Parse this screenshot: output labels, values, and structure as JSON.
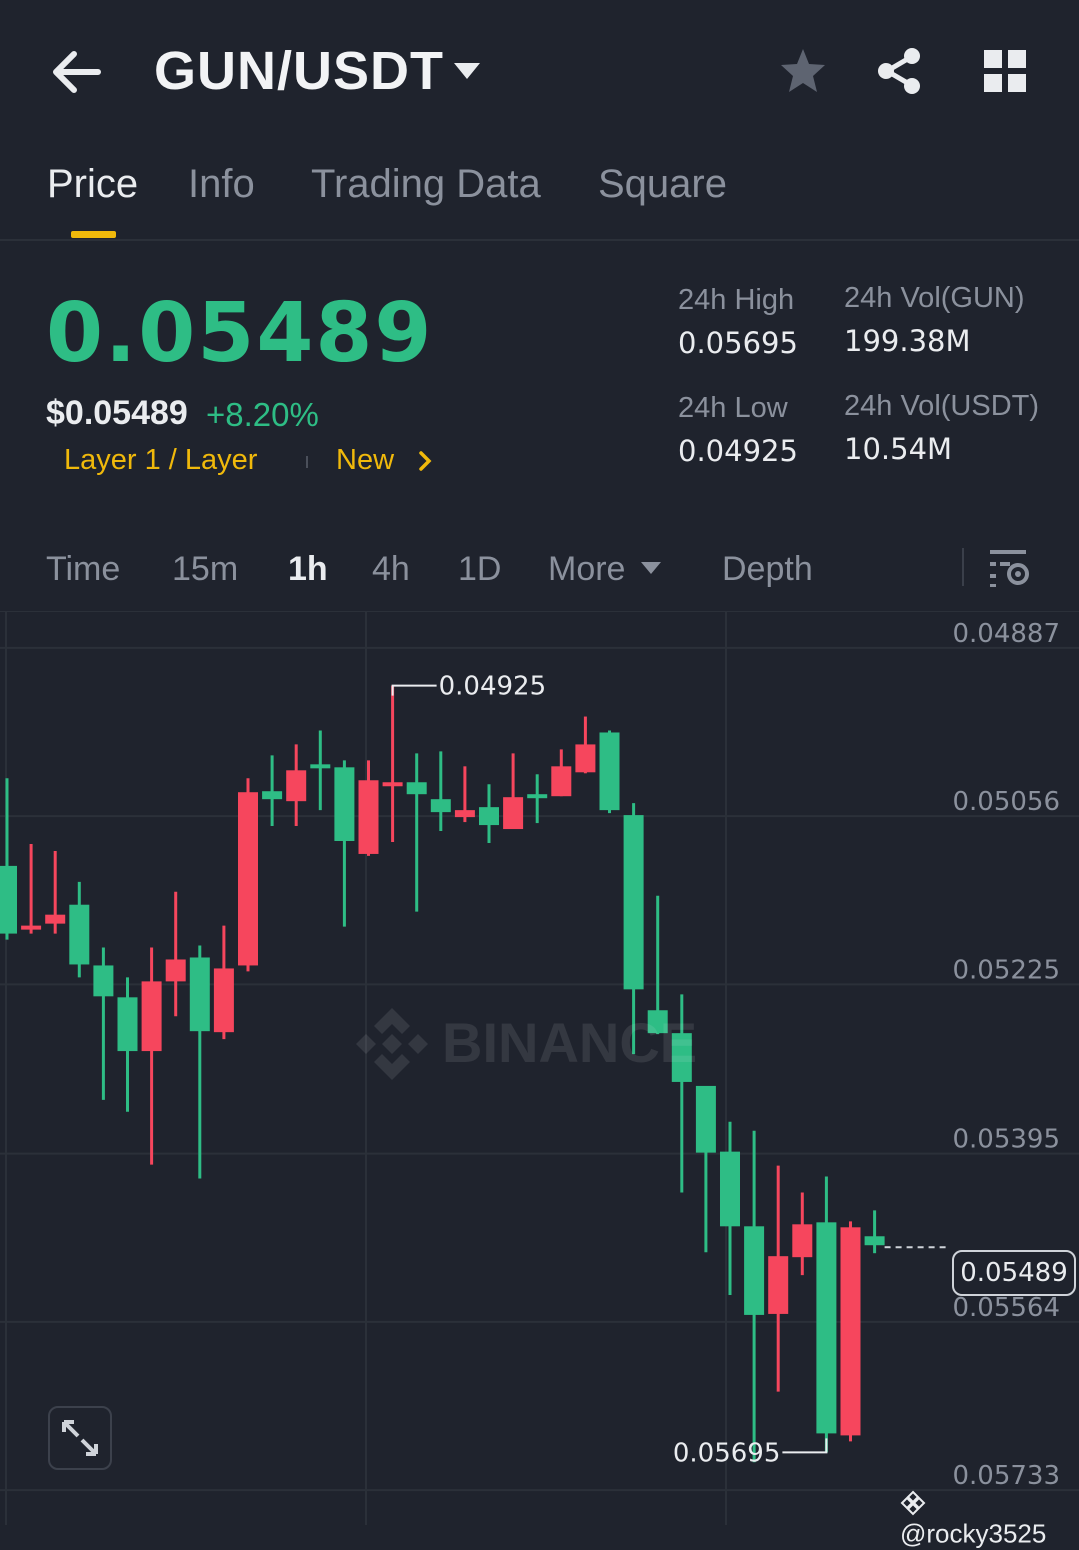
{
  "header": {
    "pair": "GUN/USDT",
    "icons": [
      "arrow-left-icon",
      "caret-down-icon",
      "star-icon",
      "share-icon",
      "grid-icon"
    ]
  },
  "tabs": [
    {
      "label": "Price",
      "active": true
    },
    {
      "label": "Info",
      "active": false
    },
    {
      "label": "Trading Data",
      "active": false
    },
    {
      "label": "Square",
      "active": false
    }
  ],
  "price": {
    "last": "0.05489",
    "usd": "$0.05489",
    "change": "+8.20%",
    "tags": [
      "Layer 1 / Layer",
      "New"
    ]
  },
  "stats": {
    "high_label": "24h High",
    "high_value": "0.05695",
    "low_label": "24h Low",
    "low_value": "0.04925",
    "vol_base_label": "24h Vol(GUN)",
    "vol_base_value": "199.38M",
    "vol_quote_label": "24h Vol(USDT)",
    "vol_quote_value": "10.54M"
  },
  "intervals": [
    {
      "label": "Time",
      "active": false
    },
    {
      "label": "15m",
      "active": false
    },
    {
      "label": "1h",
      "active": true
    },
    {
      "label": "4h",
      "active": false
    },
    {
      "label": "1D",
      "active": false
    },
    {
      "label": "More",
      "active": false
    },
    {
      "label": "Depth",
      "active": false
    }
  ],
  "colors": {
    "up": "#2ebd85",
    "down": "#f6465d",
    "accent": "#f0b90b",
    "background": "#1f232d"
  },
  "watermark": "BINANCE",
  "user_handle": "@rocky3525",
  "chart_data": {
    "type": "candlestick",
    "y_inverted": true,
    "y_ticks": [
      "0.04887",
      "0.05056",
      "0.05225",
      "0.05395",
      "0.05564",
      "0.05733"
    ],
    "ylim": [
      0.04851,
      0.05768
    ],
    "current_price": "0.05489",
    "high_marker": "0.04925",
    "low_marker": "0.05695",
    "grid": true,
    "candles": [
      {
        "o": 0.05174,
        "h": 0.05018,
        "l": 0.0518,
        "c": 0.05106,
        "up": true
      },
      {
        "o": 0.05166,
        "h": 0.05084,
        "l": 0.05174,
        "c": 0.05166,
        "up": false
      },
      {
        "o": 0.05155,
        "h": 0.05091,
        "l": 0.05174,
        "c": 0.05164,
        "up": false
      },
      {
        "o": 0.05205,
        "h": 0.05122,
        "l": 0.05218,
        "c": 0.05145,
        "up": true
      },
      {
        "o": 0.05237,
        "h": 0.05188,
        "l": 0.05341,
        "c": 0.05206,
        "up": true
      },
      {
        "o": 0.05292,
        "h": 0.05218,
        "l": 0.05353,
        "c": 0.05238,
        "up": true
      },
      {
        "o": 0.05222,
        "h": 0.05188,
        "l": 0.05406,
        "c": 0.05292,
        "up": false
      },
      {
        "o": 0.052,
        "h": 0.05132,
        "l": 0.05257,
        "c": 0.05222,
        "up": false
      },
      {
        "o": 0.05272,
        "h": 0.05186,
        "l": 0.0542,
        "c": 0.05198,
        "up": true
      },
      {
        "o": 0.05209,
        "h": 0.05166,
        "l": 0.0528,
        "c": 0.05273,
        "up": false
      },
      {
        "o": 0.05032,
        "h": 0.05018,
        "l": 0.05212,
        "c": 0.05206,
        "up": false
      },
      {
        "o": 0.05039,
        "h": 0.04995,
        "l": 0.05066,
        "c": 0.05031,
        "up": true
      },
      {
        "o": 0.0501,
        "h": 0.04984,
        "l": 0.05066,
        "c": 0.05041,
        "up": false
      },
      {
        "o": 0.05007,
        "h": 0.0497,
        "l": 0.0505,
        "c": 0.05004,
        "up": true
      },
      {
        "o": 0.05081,
        "h": 0.05,
        "l": 0.05167,
        "c": 0.05007,
        "up": true
      },
      {
        "o": 0.0502,
        "h": 0.05,
        "l": 0.05096,
        "c": 0.05094,
        "up": false
      },
      {
        "o": 0.05022,
        "h": 0.04925,
        "l": 0.05082,
        "c": 0.05025,
        "up": false
      },
      {
        "o": 0.05034,
        "h": 0.04993,
        "l": 0.05152,
        "c": 0.05022,
        "up": true
      },
      {
        "o": 0.05052,
        "h": 0.04991,
        "l": 0.05071,
        "c": 0.05039,
        "up": true
      },
      {
        "o": 0.0505,
        "h": 0.05006,
        "l": 0.05062,
        "c": 0.05057,
        "up": false
      },
      {
        "o": 0.05065,
        "h": 0.05024,
        "l": 0.05083,
        "c": 0.05047,
        "up": true
      },
      {
        "o": 0.05037,
        "h": 0.04993,
        "l": 0.05067,
        "c": 0.05069,
        "up": false
      },
      {
        "o": 0.05036,
        "h": 0.05014,
        "l": 0.05063,
        "c": 0.05034,
        "up": true
      },
      {
        "o": 0.05006,
        "h": 0.04989,
        "l": 0.05036,
        "c": 0.05036,
        "up": false
      },
      {
        "o": 0.04984,
        "h": 0.04956,
        "l": 0.05013,
        "c": 0.05012,
        "up": false
      },
      {
        "o": 0.0505,
        "h": 0.0497,
        "l": 0.05053,
        "c": 0.04972,
        "up": true
      },
      {
        "o": 0.0523,
        "h": 0.05043,
        "l": 0.05295,
        "c": 0.05055,
        "up": true
      },
      {
        "o": 0.05274,
        "h": 0.05136,
        "l": 0.05275,
        "c": 0.05251,
        "up": true
      },
      {
        "o": 0.05323,
        "h": 0.05235,
        "l": 0.05434,
        "c": 0.05274,
        "up": true
      },
      {
        "o": 0.05394,
        "h": 0.05332,
        "l": 0.05494,
        "c": 0.05327,
        "up": true
      },
      {
        "o": 0.05468,
        "h": 0.05363,
        "l": 0.05537,
        "c": 0.05393,
        "up": true
      },
      {
        "o": 0.05557,
        "h": 0.05372,
        "l": 0.05705,
        "c": 0.05468,
        "up": true
      },
      {
        "o": 0.05498,
        "h": 0.05407,
        "l": 0.05634,
        "c": 0.05556,
        "up": false
      },
      {
        "o": 0.05466,
        "h": 0.05434,
        "l": 0.05517,
        "c": 0.05499,
        "up": false
      },
      {
        "o": 0.05676,
        "h": 0.05418,
        "l": 0.05695,
        "c": 0.05464,
        "up": true
      },
      {
        "o": 0.05469,
        "h": 0.05463,
        "l": 0.05684,
        "c": 0.05678,
        "up": false
      },
      {
        "o": 0.05487,
        "h": 0.05452,
        "l": 0.05495,
        "c": 0.05478,
        "up": true
      }
    ]
  }
}
